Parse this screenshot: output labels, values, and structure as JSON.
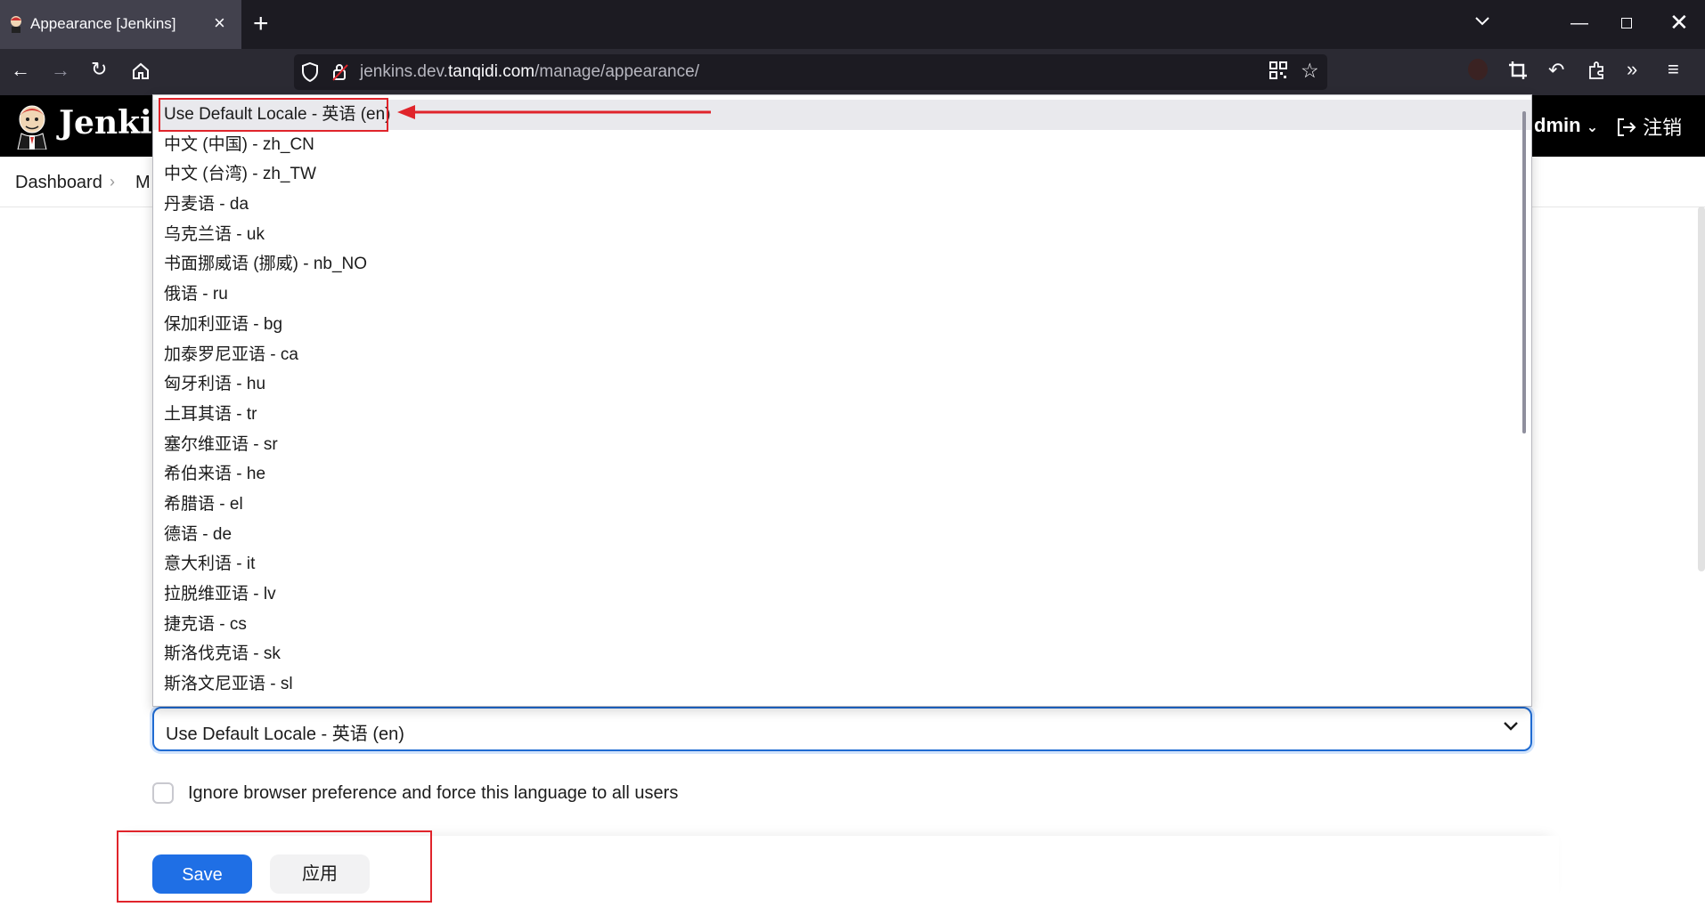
{
  "browser": {
    "tab_title": "Appearance [Jenkins]",
    "url_host": "jenkins.dev.tanqidi.com",
    "url_prefix": "jenkins.dev.",
    "url_domain": "tanqidi.com",
    "url_path": "/manage/appearance/"
  },
  "header": {
    "brand": "Jenki",
    "user_label": "dmin",
    "logout_label": "注销"
  },
  "breadcrumb": {
    "dashboard": "Dashboard",
    "manage": "M"
  },
  "locale": {
    "selected_value": "Use Default Locale - 英语 (en)",
    "options": [
      "Use Default Locale - 英语 (en)",
      "中文 (中国) - zh_CN",
      "中文 (台湾) - zh_TW",
      "丹麦语 - da",
      "乌克兰语 - uk",
      "书面挪威语 (挪威) - nb_NO",
      "俄语 - ru",
      "保加利亚语 - bg",
      "加泰罗尼亚语 - ca",
      "匈牙利语 - hu",
      "土耳其语 - tr",
      "塞尔维亚语 - sr",
      "希伯来语 - he",
      "希腊语 - el",
      "德语 - de",
      "意大利语 - it",
      "拉脱维亚语 - lv",
      "捷克语 - cs",
      "斯洛伐克语 - sk",
      "斯洛文尼亚语 - sl"
    ],
    "ignore_checkbox_label": "Ignore browser preference and force this language to all users",
    "ignore_checked": false
  },
  "actions": {
    "save_label": "Save",
    "apply_label": "应用"
  },
  "colors": {
    "primary": "#1f6fe5",
    "annotation": "#e0242b"
  }
}
